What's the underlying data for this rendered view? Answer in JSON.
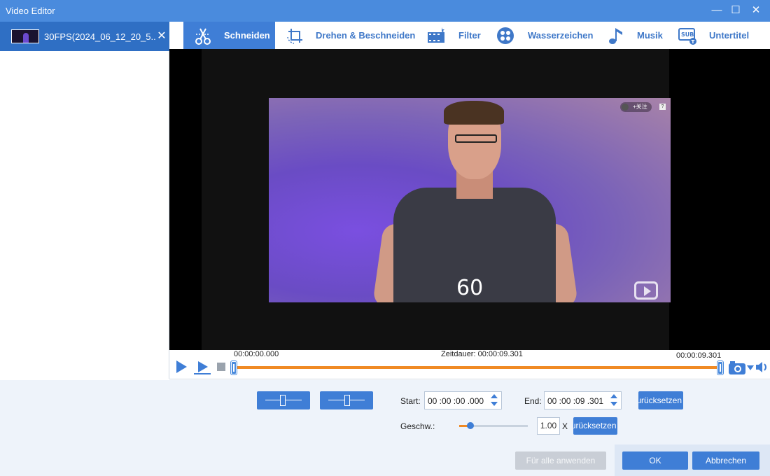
{
  "window": {
    "title": "Video Editor",
    "minimize_glyph": "—",
    "maximize_glyph": "☐",
    "close_glyph": "✕"
  },
  "sidebar": {
    "file_name": "30FPS(2024_06_12_20_5...",
    "close_glyph": "✕"
  },
  "tabs": [
    {
      "label": "Schneiden",
      "icon": "scissors-icon",
      "active": true
    },
    {
      "label": "Drehen & Beschneiden",
      "icon": "crop-rotate-icon",
      "active": false
    },
    {
      "label": "Filter",
      "icon": "filter-film-icon",
      "active": false
    },
    {
      "label": "Wasserzeichen",
      "icon": "watermark-icon",
      "active": false
    },
    {
      "label": "Musik",
      "icon": "music-note-icon",
      "active": false
    },
    {
      "label": "Untertitel",
      "icon": "subtitle-icon",
      "active": false
    }
  ],
  "video": {
    "overlay_number": "60",
    "follow_badge": "+关注",
    "help_badge": "?"
  },
  "timeline": {
    "start_time": "00:00:00.000",
    "duration_label": "Zeitdauer: 00:00:09.301",
    "end_time": "00:00:09.301"
  },
  "trim": {
    "start_label": "Start:",
    "start_value": "00 :00 :00 .000",
    "end_label": "End:",
    "end_value": "00 :00 :09 .301",
    "reset_label": "Zurücksetzen",
    "speed_label": "Geschw.:",
    "speed_value": "1.00",
    "speed_unit": "X",
    "speed_level_percent": 15,
    "speed_reset_label": "Zurücksetzen"
  },
  "footer": {
    "apply_all_label": "Für alle anwenden",
    "ok_label": "OK",
    "cancel_label": "Abbrechen"
  },
  "colors": {
    "accent": "#3f7ed6",
    "titlebar": "#4a8bdd",
    "progress": "#f08a24"
  }
}
